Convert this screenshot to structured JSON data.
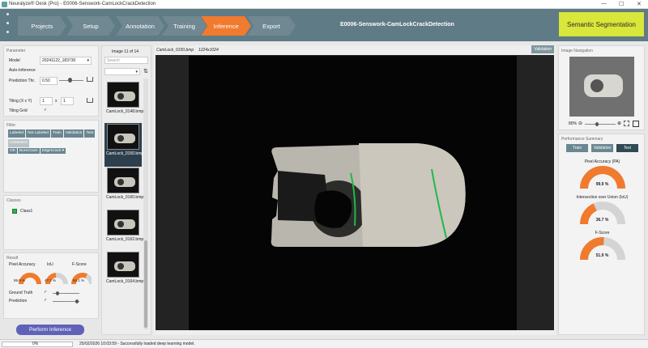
{
  "window": {
    "title": "Neuralyze® Desk (Pro) - E0006-Senswork-CamLockCrackDetection",
    "min": "—",
    "max": "☐",
    "close": "✕"
  },
  "nav": {
    "steps": [
      "Projects",
      "Setup",
      "Annotation",
      "Training",
      "Inference",
      "Export"
    ],
    "active": "Inference",
    "project_title": "E0006-Senswork-CamLockCrackDetection",
    "mode_badge": "Semantic Segmentation"
  },
  "parameter": {
    "title": "Parameter",
    "model_label": "Model",
    "model_value": "20241122_183730",
    "auto_label": "Auto-Inference",
    "pred_label": "Prediction Thr.",
    "pred_value": "0.50",
    "tiling_label": "Tiling (X x Y)",
    "tiling_x": "1",
    "tiling_sep": "x",
    "tiling_y": "1",
    "grid_label": "Tiling Grid",
    "grid_check": "✓"
  },
  "filter": {
    "title": "Filter",
    "tags": [
      "Labeled",
      "Not Labeled",
      "Train",
      "Validation",
      "Test"
    ],
    "tag_unl": "Unlabeled",
    "classes_tags": [
      "OK",
      "BoreCrack",
      "EdgeCrack ▾"
    ]
  },
  "classes": {
    "title": "Classes",
    "items": [
      "Class1"
    ],
    "color": "#2fb34a"
  },
  "result": {
    "title": "Result",
    "metrics": [
      {
        "name": "Pixel Accuracy",
        "value": "99.9 %",
        "pct": 99.9
      },
      {
        "name": "IoU",
        "value": "47.2 %",
        "pct": 47.2
      },
      {
        "name": "F-Score",
        "value": "64.1 %",
        "pct": 64.1
      }
    ],
    "gt_label": "Ground Truth",
    "pred_label": "Prediction",
    "check": "✓",
    "button": "Perform Inference"
  },
  "images": {
    "image_label": "Image",
    "current": "11",
    "of_label": "of",
    "total": "14",
    "search_placeholder": "Search",
    "items": [
      "CamLock_0148.bmp",
      "CamLock_0150.bmp",
      "CamLock_0160.bmp",
      "CamLock_0162.bmp",
      "CamLock_0164.bmp"
    ],
    "selected_index": 1
  },
  "viewer": {
    "filename": "CamLock_0150.bmp",
    "size": "1224x1024",
    "split_badge": "Validation"
  },
  "navigation": {
    "title": "Image Navigation",
    "zoom": "80%"
  },
  "performance": {
    "title": "Performance Summary",
    "tabs": [
      "Train",
      "Validation",
      "Test"
    ],
    "active_tab": "Test",
    "metrics": [
      {
        "name": "Pixel Accuracy (PA)",
        "value": "99.9 %",
        "pct": 99.9
      },
      {
        "name": "Intersection over Union (IoU)",
        "value": "36.7 %",
        "pct": 36.7
      },
      {
        "name": "F-Score",
        "value": "51.9 %",
        "pct": 51.9
      }
    ]
  },
  "status": {
    "progress": "0%",
    "progress_pct": 0,
    "message": "25/02/2026 10:03:59 - Successfully loaded deep learning model."
  },
  "colors": {
    "accent": "#f07a2e",
    "nav": "#5f7b85",
    "badge": "#d9e63a",
    "gauge_bg": "#d4d4d4",
    "label_line": "#1fb84a"
  }
}
